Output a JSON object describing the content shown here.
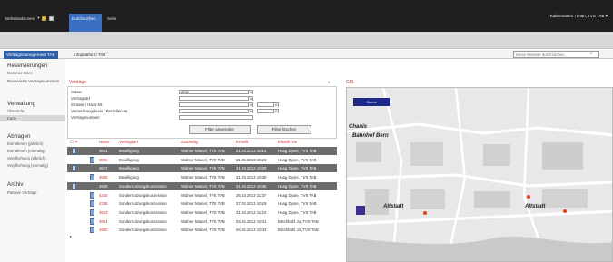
{
  "topbar": {
    "site_actions": "Websiteaktionen",
    "tab_browse": "Durchsuchen",
    "tab_page": "Seite",
    "user": "Kaltermatten Timan, TVS TAB"
  },
  "nav": {
    "tabs": [
      "Vertragsmanagement TAB",
      "Infoplattform TAB"
    ],
    "search_placeholder": "Diese Website durchsuchen..."
  },
  "sidebar": {
    "sections": [
      {
        "title": "Reservierungen",
        "items": [
          "Nummer lösen",
          "Reservierte Vertragsnummern"
        ]
      },
      {
        "title": "Verwaltung",
        "items": [
          "Übersicht",
          "Karte"
        ]
      },
      {
        "title": "Abfragen",
        "items": [
          "Einnahmen (jährlich)",
          "Einnahmen (einmalig)",
          "Verpflichtung (jährlich)",
          "Verpflichtung (einmalig)"
        ]
      },
      {
        "title": "Archiv",
        "items": [
          "Passive Verträge"
        ]
      }
    ],
    "selected": "Karte"
  },
  "vertrage": {
    "title": "Verträge",
    "indicator": "▾",
    "filter": {
      "labels": [
        "Status",
        "Vertragsart",
        "Strasse / Haus-Nr.",
        "Vermessungskreis / Parzellen-Nr.",
        "Vertragsnummer"
      ],
      "status_value": "aktiv",
      "apply": "Filter anwenden",
      "clear": "Filter löschen"
    },
    "columns": [
      "Name",
      "Vertragsart",
      "Zuständig",
      "Erstellt",
      "Erstellt von"
    ],
    "rows": [
      {
        "name": "3851",
        "art": "Bewilligung",
        "zust": "Widmer Marcel, TVS TAB",
        "erst": "21.03.2013 10:14",
        "von": "Haag Djune, TVS TAB",
        "selected": true
      },
      {
        "name": "3856",
        "art": "Bewilligung",
        "zust": "Widmer Marcel, TVS TAB",
        "erst": "21.03.2013 10:19",
        "von": "Haag Djune, TVS TAB",
        "selected": false
      },
      {
        "name": "3857",
        "art": "Bewilligung",
        "zust": "Widmer Marcel, TVS TAB",
        "erst": "21.03.2013 10:29",
        "von": "Haag Djune, TVS TAB",
        "selected": true
      },
      {
        "name": "3858",
        "art": "Bewilligung",
        "zust": "Widmer Marcel, TVS TAB",
        "erst": "21.03.2013 10:30",
        "von": "Haag Djune, TVS TAB",
        "selected": false
      },
      {
        "name": "4525",
        "art": "Sondernutzungskonzession",
        "zust": "Widmer Marcel, TVS TAB",
        "erst": "21.03.2013 10:45",
        "von": "Haag Djune, TVS TAB",
        "selected": true
      },
      {
        "name": "4316",
        "art": "Sondernutzungskonzession",
        "zust": "Widmer Marcel, TVS TAB",
        "erst": "26.03.2013 11:37",
        "von": "Haag Djune, TVS TAB",
        "selected": false
      },
      {
        "name": "4338",
        "art": "Sondernutzungskonzession",
        "zust": "Widmer Marcel, TVS TAB",
        "erst": "27.03.2013 10:19",
        "von": "Haag Djune, TVS TAB",
        "selected": false
      },
      {
        "name": "4563",
        "art": "Sondernutzungskonzession",
        "zust": "Widmer Marcel, TVS TAB",
        "erst": "21.03.2013 11:24",
        "von": "Haag Djune, TVS TAB",
        "selected": false
      },
      {
        "name": "4894",
        "art": "Sondernutzungskonzession",
        "zust": "Widmer Marcel, TVS TAB",
        "erst": "04.04.2013 10:41",
        "von": "Brechbühl Jo, TVS TAB",
        "selected": false
      },
      {
        "name": "4900",
        "art": "Sondernutzungskonzession",
        "zust": "Widmer Marcel, TVS TAB",
        "erst": "04.04.2013 10:43",
        "von": "Brechbühl Jo, TVS TAB",
        "selected": false
      }
    ]
  },
  "map": {
    "title": "GIS",
    "search_label": "Suche",
    "labels": [
      "Chanis",
      "Bahnhof Bern",
      "Altstadt",
      "Altstadt"
    ]
  },
  "colors": {
    "accent": "#3a6fc1",
    "red": "#cc3333",
    "selected_row": "#6c6c6c"
  }
}
